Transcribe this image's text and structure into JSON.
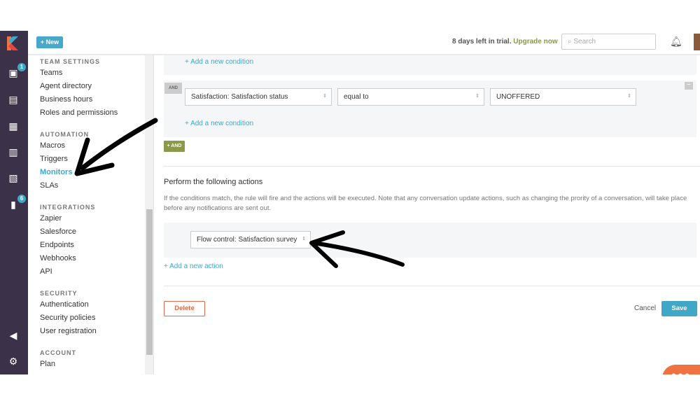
{
  "topbar": {
    "new_label": "+ New",
    "trial_text": "8 days left in trial.",
    "upgrade": "Upgrade now",
    "search_placeholder": "Search"
  },
  "rail": {
    "inbox_badge": "1",
    "kb_badge": "6"
  },
  "sidebar": {
    "team_settings": "TEAM SETTINGS",
    "team_items": [
      "Teams",
      "Agent directory",
      "Business hours",
      "Roles and permissions"
    ],
    "automation": "AUTOMATION",
    "automation_items": [
      "Macros",
      "Triggers",
      "Monitors",
      "SLAs"
    ],
    "integrations": "INTEGRATIONS",
    "integration_items": [
      "Zapier",
      "Salesforce",
      "Endpoints",
      "Webhooks",
      "API"
    ],
    "security": "SECURITY",
    "security_items": [
      "Authentication",
      "Security policies",
      "User registration"
    ],
    "account": "ACCOUNT",
    "account_items": [
      "Plan"
    ]
  },
  "conditions": {
    "add_condition": "+ Add a new condition",
    "and_tag": "AND",
    "field": "Satisfaction: Satisfaction status",
    "operator": "equal to",
    "value": "UNOFFERED",
    "add_and": "+ AND"
  },
  "actions": {
    "title": "Perform the following actions",
    "description": "If the conditions match, the rule will fire and the actions will be executed. Note that any conversation update actions, such as changing the prority of a conversation, will take place before any notifications are sent out.",
    "action": "Flow control: Satisfaction survey",
    "add_action": "+ Add a new action"
  },
  "footer": {
    "delete": "Delete",
    "cancel": "Cancel",
    "save": "Save"
  },
  "colors": {
    "rail": "#3b3249",
    "accent": "#3fa8c9",
    "upgrade": "#8b9a3a",
    "delete": "#e06a4a",
    "chat": "#f07142"
  }
}
